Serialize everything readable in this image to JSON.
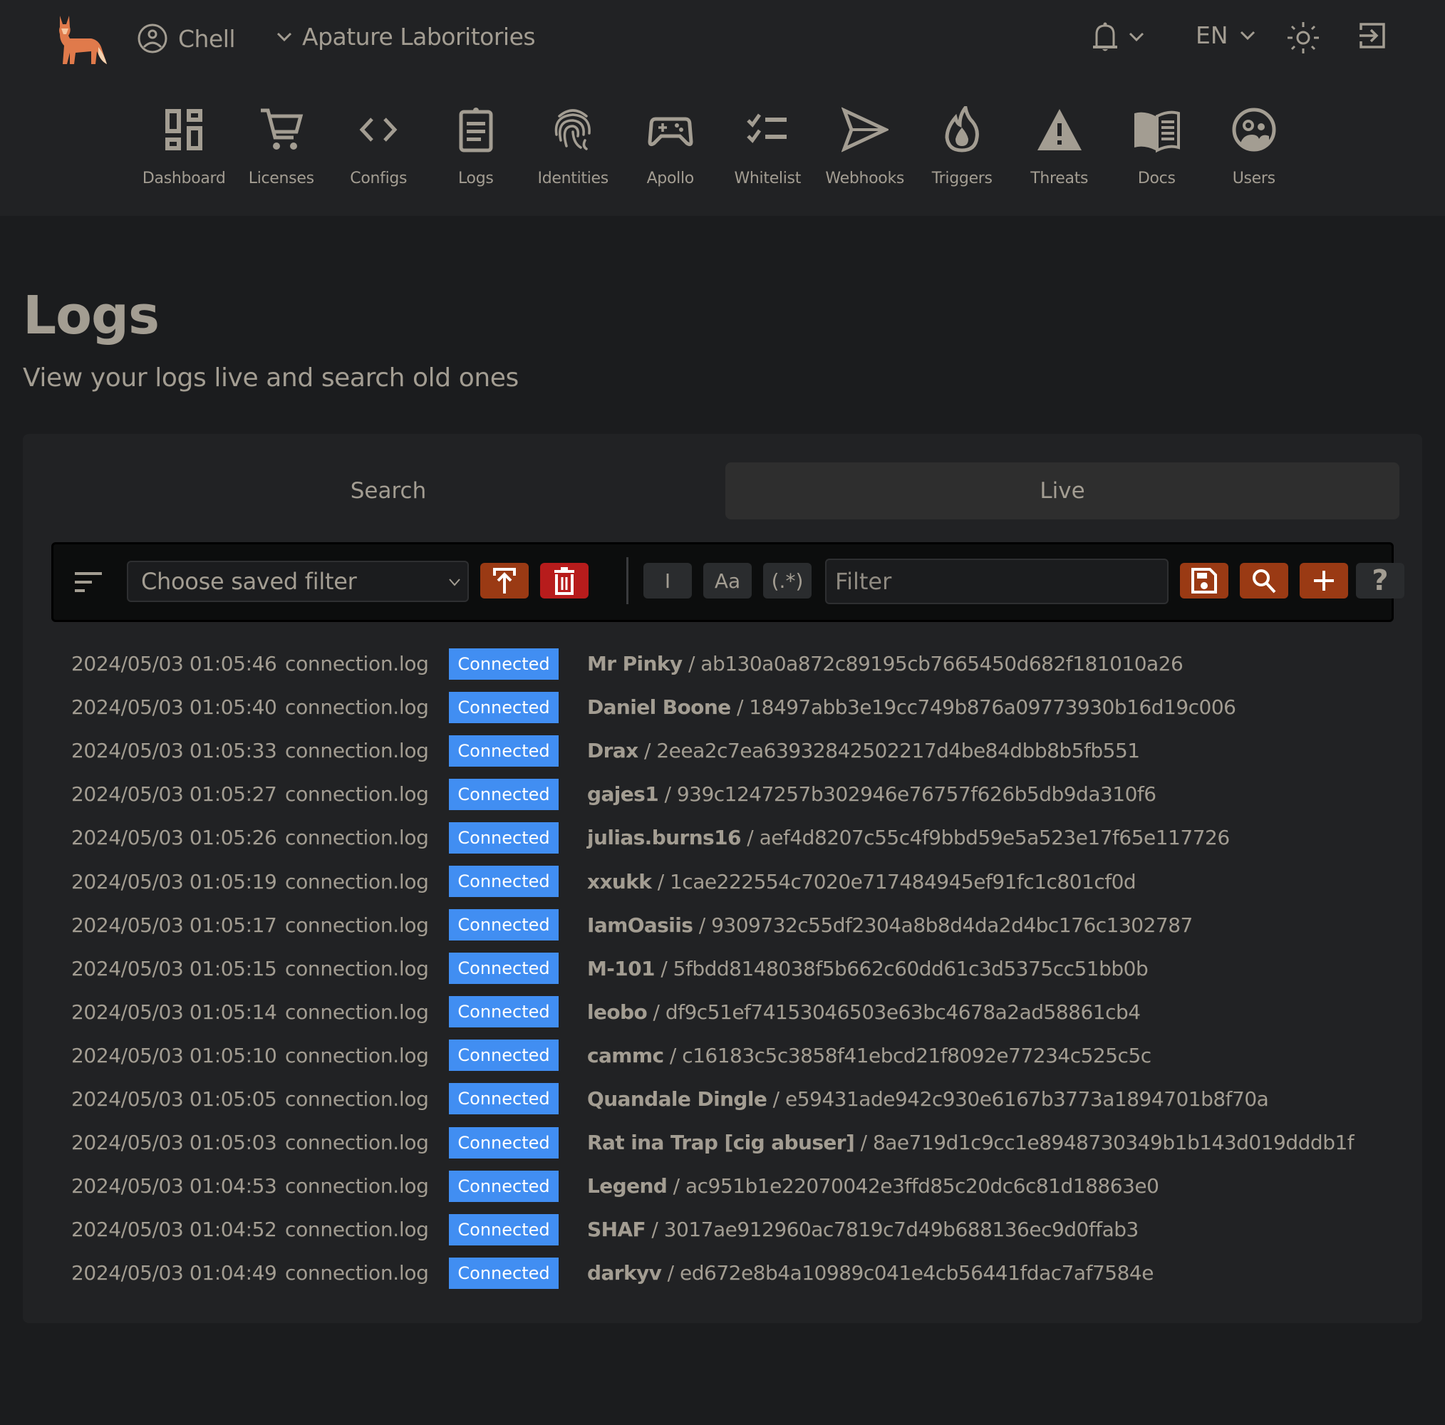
{
  "header": {
    "logo": "fox-logo",
    "user_name": "Chell",
    "org_name": "Apature Laboritories",
    "language": "EN",
    "icons": {
      "user": "user-circle-icon",
      "org_dropdown": "chevron-down-icon",
      "notifications": "bell-icon",
      "theme": "sun-icon",
      "logout": "logout-icon"
    }
  },
  "nav": [
    {
      "label": "Dashboard",
      "icon": "dashboard-icon"
    },
    {
      "label": "Licenses",
      "icon": "cart-icon"
    },
    {
      "label": "Configs",
      "icon": "code-icon"
    },
    {
      "label": "Logs",
      "icon": "clipboard-icon"
    },
    {
      "label": "Identities",
      "icon": "fingerprint-icon"
    },
    {
      "label": "Apollo",
      "icon": "gamepad-icon"
    },
    {
      "label": "Whitelist",
      "icon": "checklist-icon"
    },
    {
      "label": "Webhooks",
      "icon": "send-icon"
    },
    {
      "label": "Triggers",
      "icon": "flame-icon"
    },
    {
      "label": "Threats",
      "icon": "warning-icon"
    },
    {
      "label": "Docs",
      "icon": "book-icon"
    },
    {
      "label": "Users",
      "icon": "users-icon"
    }
  ],
  "page": {
    "title": "Logs",
    "subtitle": "View your logs live and search old ones"
  },
  "tabs": [
    {
      "label": "Search",
      "active": false
    },
    {
      "label": "Live",
      "active": true
    }
  ],
  "toolbar": {
    "saved_filter_placeholder": "Choose saved filter",
    "cursor_toggle_label": "I",
    "case_toggle_label": "Aa",
    "regex_toggle_label": "(.*)",
    "filter_placeholder": "Filter",
    "filter_value": "",
    "help_label": "?"
  },
  "colors": {
    "accent": "#9a3a14",
    "danger": "#b71c1c",
    "badge": "#418ef2",
    "text": "#a39d92",
    "background": "#1b1c1e",
    "surface": "#212224"
  },
  "logs": [
    {
      "timestamp": "2024/05/03 01:05:46",
      "file": "connection.log",
      "status": "Connected",
      "user": "Mr Pinky",
      "hash": "ab130a0a872c89195cb7665450d682f181010a26"
    },
    {
      "timestamp": "2024/05/03 01:05:40",
      "file": "connection.log",
      "status": "Connected",
      "user": "Daniel Boone",
      "hash": "18497abb3e19cc749b876a09773930b16d19c006"
    },
    {
      "timestamp": "2024/05/03 01:05:33",
      "file": "connection.log",
      "status": "Connected",
      "user": "Drax",
      "hash": "2eea2c7ea63932842502217d4be84dbb8b5fb551"
    },
    {
      "timestamp": "2024/05/03 01:05:27",
      "file": "connection.log",
      "status": "Connected",
      "user": "gajes1",
      "hash": "939c1247257b302946e76757f626b5db9da310f6"
    },
    {
      "timestamp": "2024/05/03 01:05:26",
      "file": "connection.log",
      "status": "Connected",
      "user": "julias.burns16",
      "hash": "aef4d8207c55c4f9bbd59e5a523e17f65e117726"
    },
    {
      "timestamp": "2024/05/03 01:05:19",
      "file": "connection.log",
      "status": "Connected",
      "user": "xxukk",
      "hash": "1cae222554c7020e717484945ef91fc1c801cf0d"
    },
    {
      "timestamp": "2024/05/03 01:05:17",
      "file": "connection.log",
      "status": "Connected",
      "user": "IamOasiis",
      "hash": "9309732c55df2304a8b8d4da2d4bc176c1302787"
    },
    {
      "timestamp": "2024/05/03 01:05:15",
      "file": "connection.log",
      "status": "Connected",
      "user": "M-101",
      "hash": "5fbdd8148038f5b662c60dd61c3d5375cc51bb0b"
    },
    {
      "timestamp": "2024/05/03 01:05:14",
      "file": "connection.log",
      "status": "Connected",
      "user": "leobo",
      "hash": "df9c51ef74153046503e63bc4678a2ad58861cb4"
    },
    {
      "timestamp": "2024/05/03 01:05:10",
      "file": "connection.log",
      "status": "Connected",
      "user": "cammc",
      "hash": "c16183c5c3858f41ebcd21f8092e77234c525c5c"
    },
    {
      "timestamp": "2024/05/03 01:05:05",
      "file": "connection.log",
      "status": "Connected",
      "user": "Quandale Dingle",
      "hash": "e59431ade942c930e6167b3773a1894701b8f70a"
    },
    {
      "timestamp": "2024/05/03 01:05:03",
      "file": "connection.log",
      "status": "Connected",
      "user": "Rat ina Trap [cig abuser]",
      "hash": "8ae719d1c9cc1e8948730349b1b143d019dddb1f"
    },
    {
      "timestamp": "2024/05/03 01:04:53",
      "file": "connection.log",
      "status": "Connected",
      "user": "Legend",
      "hash": "ac951b1e22070042e3ffd85c20dc6c81d18863e0"
    },
    {
      "timestamp": "2024/05/03 01:04:52",
      "file": "connection.log",
      "status": "Connected",
      "user": "SHAF",
      "hash": "3017ae912960ac7819c7d49b688136ec9d0ffab3"
    },
    {
      "timestamp": "2024/05/03 01:04:49",
      "file": "connection.log",
      "status": "Connected",
      "user": "darkyv",
      "hash": "ed672e8b4a10989c041e4cb56441fdac7af7584e"
    }
  ]
}
